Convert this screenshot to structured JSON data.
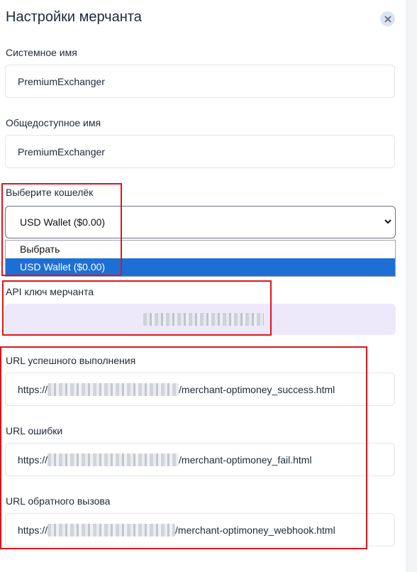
{
  "header": {
    "title": "Настройки мерчанта"
  },
  "fields": {
    "system_name": {
      "label": "Системное имя",
      "value": "PremiumExchanger"
    },
    "public_name": {
      "label": "Общедоступное имя",
      "value": "PremiumExchanger"
    },
    "wallet": {
      "label": "Выберите кошелёк",
      "selected": "USD Wallet ($0.00)",
      "options": [
        "Выбрать",
        "USD Wallet ($0.00)"
      ]
    },
    "api_key": {
      "label": "API ключ мерчанта"
    },
    "success_url": {
      "label": "URL успешного выполнения",
      "prefix": "https://",
      "suffix": "/merchant-optimoney_success.html"
    },
    "fail_url": {
      "label": "URL ошибки",
      "prefix": "https://",
      "suffix": "/merchant-optimoney_fail.html"
    },
    "webhook_url": {
      "label": "URL обратного вызова",
      "prefix": "https://",
      "suffix": "/merchant-optimoney_webhook.html"
    }
  },
  "colors": {
    "highlight_border": "#e0141b",
    "selected_option": "#1d6fd6",
    "api_field_bg": "#eee8fb"
  }
}
